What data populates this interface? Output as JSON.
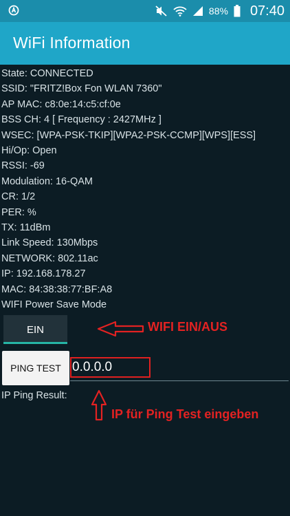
{
  "statusbar": {
    "battery_percent": "88%",
    "time": "07:40",
    "icons": [
      "mute-icon",
      "wifi-icon",
      "signal-icon",
      "battery-icon"
    ]
  },
  "appbar": {
    "title": "WiFi Information"
  },
  "info_lines": [
    "State: CONNECTED",
    "SSID: \"FRITZ!Box Fon WLAN 7360\"",
    "AP MAC: c8:0e:14:c5:cf:0e",
    "BSS CH: 4  [ Frequency : 2427MHz ]",
    "WSEC: [WPA-PSK-TKIP][WPA2-PSK-CCMP][WPS][ESS]",
    "Hi/Op: Open",
    "RSSI: -69",
    "Modulation: 16-QAM",
    "CR: 1/2",
    "PER:  %",
    "TX: 11dBm",
    "Link Speed: 130Mbps",
    "NETWORK: 802.11ac",
    "IP: 192.168.178.27",
    "MAC: 84:38:38:77:BF:A8",
    "WIFI Power Save Mode"
  ],
  "toggle": {
    "label": "EIN"
  },
  "ping": {
    "button_label": "PING TEST",
    "ip_value": "0.0.0.0",
    "result_label": "IP Ping Result:"
  },
  "annotations": {
    "wifi_toggle": "WIFI  EIN/AUS",
    "ping_input": "IP für Ping Test eingeben"
  },
  "colors": {
    "statusbar": "#1b8dab",
    "appbar": "#1fa6c8",
    "background": "#0c1c24",
    "annotation_red": "#e32222",
    "toggle_accent": "#26b5a6"
  }
}
